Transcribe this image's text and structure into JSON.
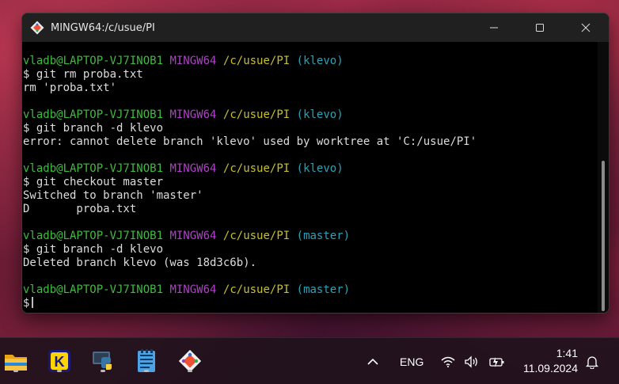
{
  "window": {
    "title": "MINGW64:/c/usue/PI"
  },
  "terminal": {
    "lines": [
      {
        "kind": "prompt",
        "user": "vladb@LAPTOP-VJ7INOB1",
        "env": "MINGW64",
        "path": "/c/usue/PI",
        "branch": "(klevo)"
      },
      {
        "kind": "text",
        "text": "$ git rm proba.txt"
      },
      {
        "kind": "text",
        "text": "rm 'proba.txt'"
      },
      {
        "kind": "blank",
        "text": ""
      },
      {
        "kind": "prompt",
        "user": "vladb@LAPTOP-VJ7INOB1",
        "env": "MINGW64",
        "path": "/c/usue/PI",
        "branch": "(klevo)"
      },
      {
        "kind": "text",
        "text": "$ git branch -d klevo"
      },
      {
        "kind": "text",
        "text": "error: cannot delete branch 'klevo' used by worktree at 'C:/usue/PI'"
      },
      {
        "kind": "blank",
        "text": ""
      },
      {
        "kind": "prompt",
        "user": "vladb@LAPTOP-VJ7INOB1",
        "env": "MINGW64",
        "path": "/c/usue/PI",
        "branch": "(klevo)"
      },
      {
        "kind": "text",
        "text": "$ git checkout master"
      },
      {
        "kind": "text",
        "text": "Switched to branch 'master'"
      },
      {
        "kind": "text",
        "text": "D       proba.txt"
      },
      {
        "kind": "blank",
        "text": ""
      },
      {
        "kind": "prompt",
        "user": "vladb@LAPTOP-VJ7INOB1",
        "env": "MINGW64",
        "path": "/c/usue/PI",
        "branch": "(master)"
      },
      {
        "kind": "text",
        "text": "$ git branch -d klevo"
      },
      {
        "kind": "text",
        "text": "Deleted branch klevo (was 18d3c6b)."
      },
      {
        "kind": "blank",
        "text": ""
      },
      {
        "kind": "prompt",
        "user": "vladb@LAPTOP-VJ7INOB1",
        "env": "MINGW64",
        "path": "/c/usue/PI",
        "branch": "(master)"
      },
      {
        "kind": "input",
        "text": "$"
      }
    ]
  },
  "colors": {
    "prompt_user": "#3fbb3f",
    "prompt_env": "#b040c8",
    "prompt_path": "#c8c02a",
    "prompt_branch": "#2aa3b8"
  },
  "taskbar": {
    "apps": [
      {
        "name": "file-explorer-icon"
      },
      {
        "name": "k-app-icon",
        "letter": "K"
      },
      {
        "name": "python-icon"
      },
      {
        "name": "notepad-icon"
      },
      {
        "name": "git-bash-icon"
      }
    ],
    "language": "ENG",
    "time": "1:41",
    "date": "11.09.2024"
  }
}
